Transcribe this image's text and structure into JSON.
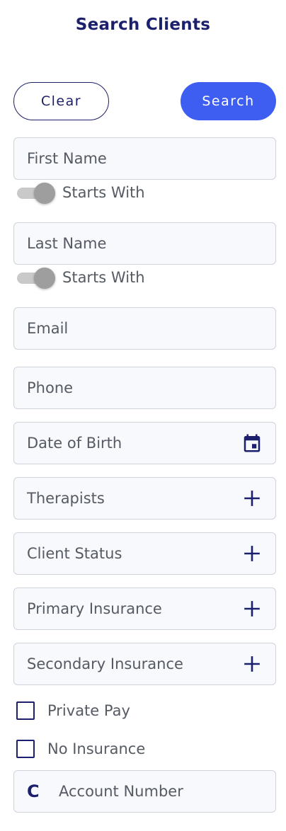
{
  "header": {
    "title": "Search Clients"
  },
  "actions": {
    "clear_label": "Clear",
    "search_label": "Search"
  },
  "fields": {
    "first_name": "First Name",
    "last_name": "Last Name",
    "email": "Email",
    "phone": "Phone",
    "dob": "Date of Birth",
    "therapists": "Therapists",
    "client_status": "Client Status",
    "primary_insurance": "Primary Insurance",
    "secondary_insurance": "Secondary Insurance",
    "account_number": "Account Number"
  },
  "toggles": {
    "first_name_starts_with": "Starts With",
    "last_name_starts_with": "Starts With"
  },
  "checkboxes": {
    "private_pay": "Private Pay",
    "no_insurance": "No Insurance"
  },
  "icons": {
    "calendar": "calendar-icon",
    "plus": "plus-icon",
    "account": "account-c-icon",
    "account_glyph": "C"
  }
}
